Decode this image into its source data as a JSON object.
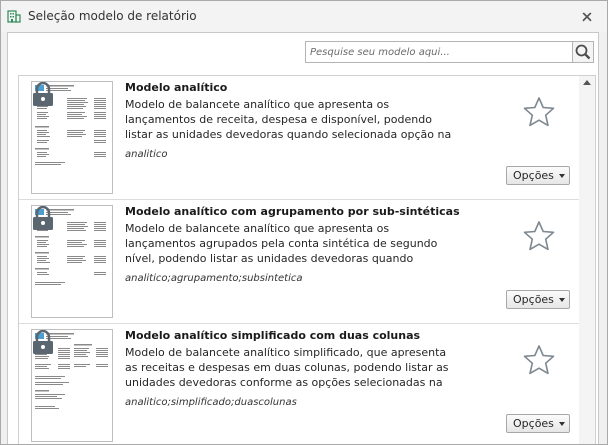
{
  "window": {
    "title": "Seleção modelo de relatório",
    "app_icon": "building-icon",
    "close_icon": "close-icon"
  },
  "search": {
    "placeholder": "Pesquise seu modelo aqui...",
    "value": "",
    "button_icon": "search-icon"
  },
  "options_label": "Opções",
  "items": [
    {
      "title": "Modelo analítico",
      "description": "Modelo de balancete analítico que apresenta os lançamentos de receita, despesa e disponível, podendo listar as unidades devedoras quando selecionada opção na geração do relatório.",
      "tags": "analitico",
      "favorite": false,
      "locked": true
    },
    {
      "title": "Modelo analítico com agrupamento por sub-sintéticas",
      "description": "Modelo de balancete analítico que apresenta os lançamentos agrupados pela conta sintética de segundo nível, podendo listar as unidades devedoras quando selecionada opção na",
      "tags": "analitico;agrupamento;subsintetica",
      "favorite": false,
      "locked": true
    },
    {
      "title": "Modelo analítico simplificado com duas colunas",
      "description": "Modelo de balancete analítico simplificado, que apresenta as receitas e despesas em duas colunas, podendo listar as unidades devedoras conforme as opções selecionadas na",
      "tags": "analitico;simplificado;duascolunas",
      "favorite": false,
      "locked": true
    }
  ],
  "colors": {
    "accent": "#4a9fd0",
    "lock": "#5a6670",
    "star_outline": "#7d8891",
    "icon_green": "#2e8b57"
  }
}
